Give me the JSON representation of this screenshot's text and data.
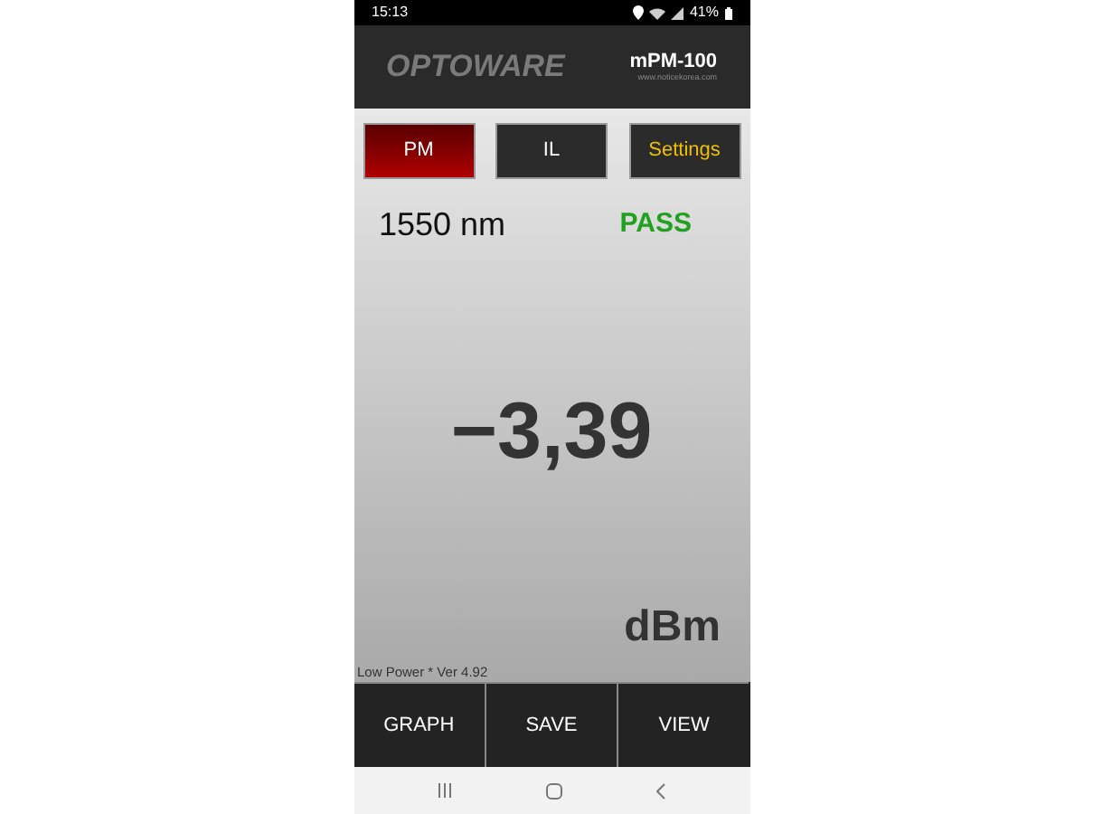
{
  "status_bar": {
    "time": "15:13",
    "battery": "41%"
  },
  "header": {
    "logo": "OPTOWARE",
    "model": "mPM-100",
    "website": "www.noticekorea.com"
  },
  "tabs": [
    {
      "label": "PM",
      "selected": true
    },
    {
      "label": "IL",
      "selected": false
    }
  ],
  "settings_button": {
    "label": "Settings"
  },
  "reading": {
    "wavelength": "1550 nm",
    "result": "PASS",
    "passed": true,
    "value": "−3,39",
    "unit": "dBm"
  },
  "footer_note": "Low Power * Ver 4.92",
  "actions": [
    "GRAPH",
    "SAVE",
    "VIEW"
  ]
}
